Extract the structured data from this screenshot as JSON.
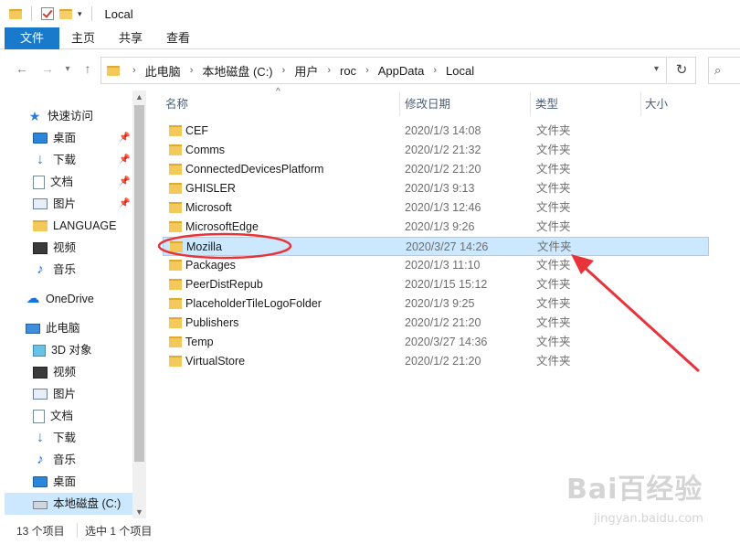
{
  "window": {
    "title": "Local"
  },
  "ribbon": {
    "tabs": [
      {
        "label": "文件"
      },
      {
        "label": "主页"
      },
      {
        "label": "共享"
      },
      {
        "label": "查看"
      }
    ]
  },
  "address": {
    "crumbs": [
      "此电脑",
      "本地磁盘 (C:)",
      "用户",
      "roc",
      "AppData",
      "Local"
    ]
  },
  "sidebar": {
    "items": [
      {
        "label": "快速访问",
        "icon": "star-icon"
      },
      {
        "label": "桌面",
        "icon": "desktop-icon",
        "pinned": true
      },
      {
        "label": "下载",
        "icon": "download-icon",
        "pinned": true
      },
      {
        "label": "文档",
        "icon": "document-icon",
        "pinned": true
      },
      {
        "label": "图片",
        "icon": "pictures-icon",
        "pinned": true
      },
      {
        "label": "LANGUAGE",
        "icon": "folder-icon"
      },
      {
        "label": "视频",
        "icon": "video-icon"
      },
      {
        "label": "音乐",
        "icon": "music-icon"
      },
      {
        "label": "OneDrive",
        "icon": "cloud-icon"
      },
      {
        "label": "此电脑",
        "icon": "computer-icon"
      },
      {
        "label": "3D 对象",
        "icon": "3d-objects-icon"
      },
      {
        "label": "视频",
        "icon": "video-icon"
      },
      {
        "label": "图片",
        "icon": "pictures-icon"
      },
      {
        "label": "文档",
        "icon": "document-icon"
      },
      {
        "label": "下载",
        "icon": "download-icon"
      },
      {
        "label": "音乐",
        "icon": "music-icon"
      },
      {
        "label": "桌面",
        "icon": "desktop-icon"
      },
      {
        "label": "本地磁盘 (C:)",
        "icon": "drive-icon",
        "selected": true
      }
    ]
  },
  "columns": {
    "name": "名称",
    "modified": "修改日期",
    "type": "类型",
    "size": "大小"
  },
  "files": [
    {
      "name": "CEF",
      "modified": "2020/1/3 14:08",
      "type": "文件夹"
    },
    {
      "name": "Comms",
      "modified": "2020/1/2 21:32",
      "type": "文件夹"
    },
    {
      "name": "ConnectedDevicesPlatform",
      "modified": "2020/1/2 21:20",
      "type": "文件夹"
    },
    {
      "name": "GHISLER",
      "modified": "2020/1/3 9:13",
      "type": "文件夹"
    },
    {
      "name": "Microsoft",
      "modified": "2020/1/3 12:46",
      "type": "文件夹"
    },
    {
      "name": "MicrosoftEdge",
      "modified": "2020/1/3 9:26",
      "type": "文件夹"
    },
    {
      "name": "Mozilla",
      "modified": "2020/3/27 14:26",
      "type": "文件夹",
      "selected": true
    },
    {
      "name": "Packages",
      "modified": "2020/1/3 11:10",
      "type": "文件夹"
    },
    {
      "name": "PeerDistRepub",
      "modified": "2020/1/15 15:12",
      "type": "文件夹"
    },
    {
      "name": "PlaceholderTileLogoFolder",
      "modified": "2020/1/3 9:25",
      "type": "文件夹"
    },
    {
      "name": "Publishers",
      "modified": "2020/1/2 21:20",
      "type": "文件夹"
    },
    {
      "name": "Temp",
      "modified": "2020/3/27 14:36",
      "type": "文件夹"
    },
    {
      "name": "VirtualStore",
      "modified": "2020/1/2 21:20",
      "type": "文件夹"
    }
  ],
  "status": {
    "count": "13 个项目",
    "selection": "选中 1 个项目"
  },
  "watermark": {
    "main": "Bai百经验",
    "sub": "jingyan.baidu.com"
  },
  "colors": {
    "accent": "#1979ca",
    "selection": "#cce8ff",
    "annotation": "#e8333a"
  }
}
